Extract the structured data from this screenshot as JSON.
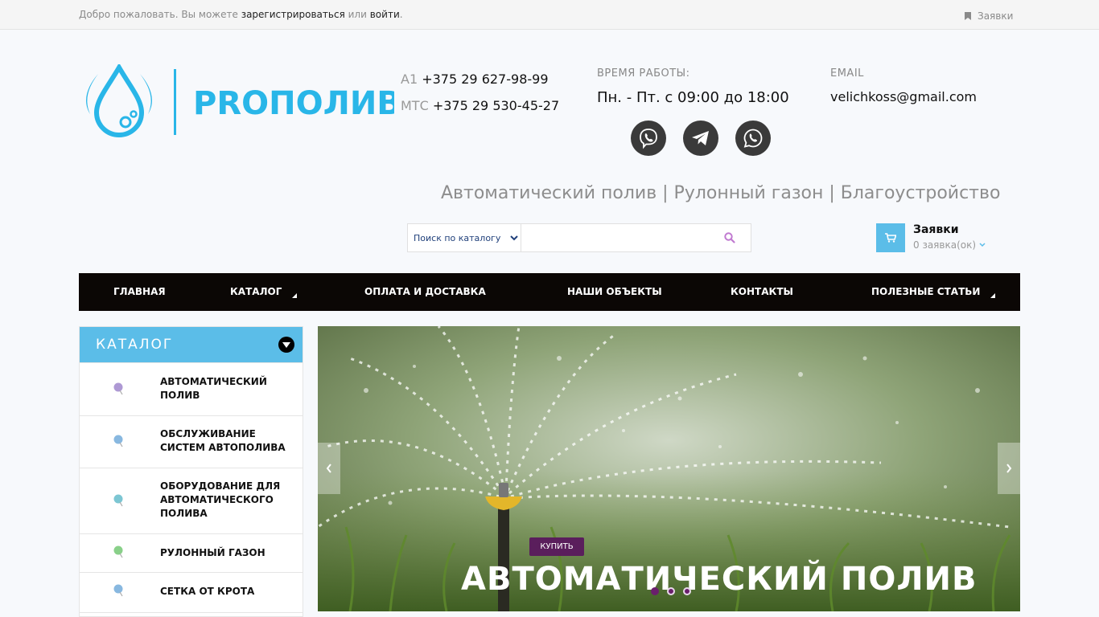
{
  "topbar": {
    "welcome_prefix": "Добро пожаловать. Вы можете",
    "register_link": "зарегистрироваться",
    "or_text": "или",
    "login_link": "войти",
    "period": ".",
    "requests_link": "Заявки"
  },
  "logo": {
    "text": "PROПОЛИВ"
  },
  "phones": [
    {
      "operator": "A1",
      "number": "+375 29 627-98-99"
    },
    {
      "operator": "МТС",
      "number": "+375 29 530-45-27"
    }
  ],
  "worktime": {
    "label": "ВРЕМЯ РАБОТЫ:",
    "hours": "Пн. - Пт. с 09:00 до 18:00"
  },
  "social": [
    "viber-icon",
    "telegram-icon",
    "whatsapp-icon"
  ],
  "email": {
    "label": "EMAIL",
    "value": "velichkoss@gmail.com"
  },
  "tagline": "Автоматический полив | Рулонный газон | Благоустройство",
  "search": {
    "category_selected": "Поиск по каталогу",
    "value": ""
  },
  "cart": {
    "title": "Заявки",
    "count": "0 заявка(ок)"
  },
  "nav": [
    {
      "label": "ГЛАВНАЯ",
      "has_sub": false
    },
    {
      "label": "КАТАЛОГ",
      "has_sub": true
    },
    {
      "label": "ОПЛАТА И ДОСТАВКА",
      "has_sub": false
    },
    {
      "label": "НАШИ ОБЪЕКТЫ",
      "has_sub": false
    },
    {
      "label": "КОНТАКТЫ",
      "has_sub": false
    },
    {
      "label": "ПОЛЕЗНЫЕ СТАТЬИ",
      "has_sub": true
    }
  ],
  "catalog": {
    "title": "КАТАЛОГ",
    "items": [
      {
        "label": "АВТОМАТИЧЕСКИЙ ПОЛИВ",
        "icon_color": "#9a7fc9"
      },
      {
        "label": "ОБСЛУЖИВАНИЕ СИСТЕМ АВТОПОЛИВА",
        "icon_color": "#6aa6d8"
      },
      {
        "label": "ОБОРУДОВАНИЕ ДЛЯ АВТОМАТИЧЕСКОГО ПОЛИВА",
        "icon_color": "#5bb8c8"
      },
      {
        "label": "РУЛОННЫЙ ГАЗОН",
        "icon_color": "#6cc46c"
      },
      {
        "label": "СЕТКА ОТ КРОТА",
        "icon_color": "#6aa6d8"
      }
    ]
  },
  "slider": {
    "buy_button": "КУПИТЬ",
    "headline": "АВТОМАТИЧЕСКИЙ ПОЛИВ",
    "active_slide": 1,
    "slide_count": 3
  },
  "colors": {
    "accent_blue": "#5bbde8",
    "nav_bg": "#0b0705",
    "buy_purple": "#5a1e5c",
    "dot_active": "#6a1f6c"
  }
}
